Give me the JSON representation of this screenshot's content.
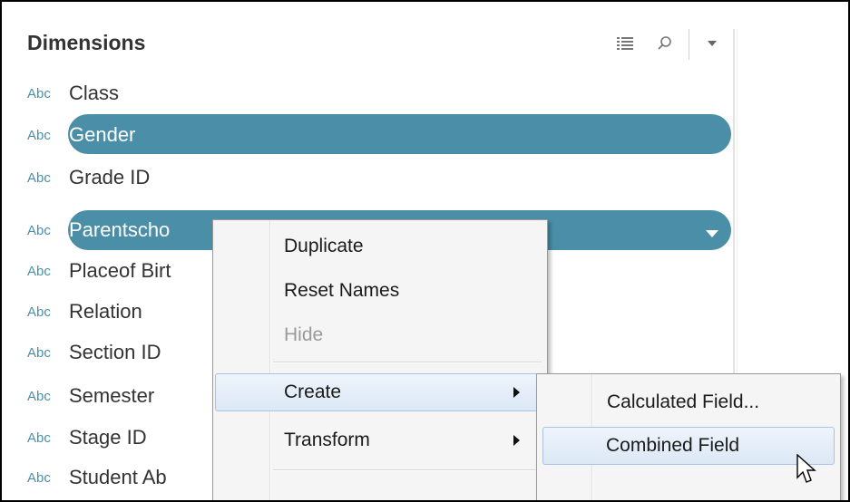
{
  "pane": {
    "title": "Dimensions"
  },
  "toolbar": {
    "view_icon": "list-view-icon",
    "search_icon": "search-icon",
    "menu_icon": "dropdown-caret-icon"
  },
  "fields": [
    {
      "type": "Abc",
      "label": "Class",
      "selected": false
    },
    {
      "type": "Abc",
      "label": "Gender",
      "selected": true
    },
    {
      "type": "Abc",
      "label": "Grade ID",
      "selected": false
    },
    {
      "type": "Abc",
      "label": "Parentscho",
      "selected": true
    },
    {
      "type": "Abc",
      "label": "Placeof Birt",
      "selected": false
    },
    {
      "type": "Abc",
      "label": "Relation",
      "selected": false
    },
    {
      "type": "Abc",
      "label": "Section ID",
      "selected": false
    },
    {
      "type": "Abc",
      "label": "Semester",
      "selected": false
    },
    {
      "type": "Abc",
      "label": "Stage ID",
      "selected": false
    },
    {
      "type": "Abc",
      "label": "Student Ab",
      "selected": false
    }
  ],
  "context_menu": {
    "items": [
      {
        "label": "Duplicate",
        "enabled": true
      },
      {
        "label": "Reset Names",
        "enabled": true
      },
      {
        "label": "Hide",
        "enabled": false
      },
      {
        "label": "Create",
        "enabled": true,
        "submenu": true,
        "highlighted": true
      },
      {
        "label": "Transform",
        "enabled": true,
        "submenu": true
      }
    ]
  },
  "submenu": {
    "items": [
      {
        "label": "Calculated Field..."
      },
      {
        "label": "Combined Field",
        "highlighted": true
      }
    ]
  },
  "colors": {
    "pill": "#4a8fa7",
    "abc": "#4a90a8",
    "menu_bg": "#f5f5f5",
    "menu_hover_border": "#a8c4e4"
  }
}
